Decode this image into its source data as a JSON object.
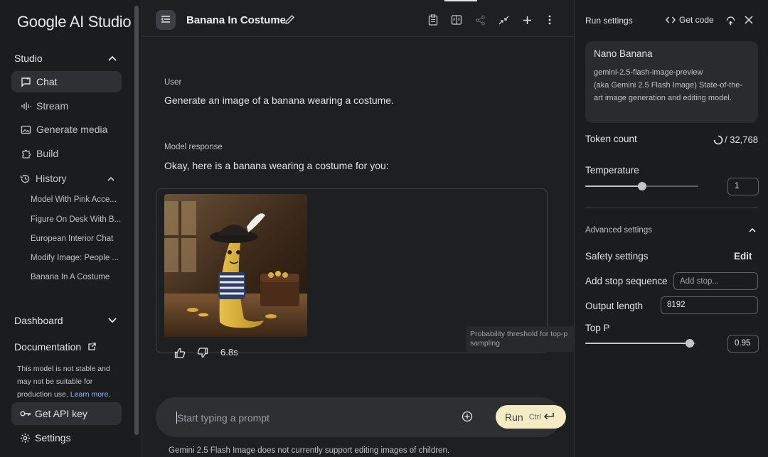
{
  "app": {
    "title": "Google AI Studio"
  },
  "sidebar": {
    "studio_label": "Studio",
    "items": [
      {
        "label": "Chat",
        "icon": "chat-icon",
        "active": true
      },
      {
        "label": "Stream",
        "icon": "stream-icon"
      },
      {
        "label": "Generate media",
        "icon": "generate-media-icon"
      },
      {
        "label": "Build",
        "icon": "build-icon"
      }
    ],
    "history_label": "History",
    "history": [
      "Model With Pink Acce...",
      "Figure On Desk With B...",
      "European Interior Chat",
      "Modify Image: People ...",
      "Banana In A Costume"
    ],
    "dashboard_label": "Dashboard",
    "documentation_label": "Documentation",
    "note_text": "This model is not stable and may not be suitable for production use.",
    "note_link": "Learn more.",
    "api_key_label": "Get API key",
    "settings_label": "Settings"
  },
  "header": {
    "title": "Banana In Costume"
  },
  "chat": {
    "user_label": "User",
    "user_message": "Generate an image of a banana wearing a costume.",
    "model_label": "Model response",
    "model_message": "Okay, here is a banana wearing a costume for you:",
    "response_time": "6.8s",
    "tooltip": "Probability threshold for top-p sampling"
  },
  "prompt": {
    "placeholder": "Start typing a prompt",
    "run_label": "Run",
    "shortcut_label": "Ctrl"
  },
  "disclaimer": "Gemini 2.5 Flash Image does not currently support editing images of children.",
  "panel": {
    "title": "Run settings",
    "get_code_label": "Get code",
    "model": {
      "name": "Nano Banana",
      "id": "gemini-2.5-flash-image-preview",
      "description": "(aka Gemini 2.5 Flash Image) State-of-the-art image generation and editing model."
    },
    "token_count_label": "Token count",
    "token_count_value": "/ 32,768",
    "temperature_label": "Temperature",
    "temperature_value": "1",
    "temperature_level": 0.5,
    "advanced_label": "Advanced settings",
    "safety_label": "Safety settings",
    "safety_action": "Edit",
    "stop_label": "Add stop sequence",
    "stop_placeholder": "Add stop...",
    "output_length_label": "Output length",
    "output_length_value": "8192",
    "top_p_label": "Top P",
    "top_p_value": "0.95",
    "top_p_level": 0.95
  }
}
